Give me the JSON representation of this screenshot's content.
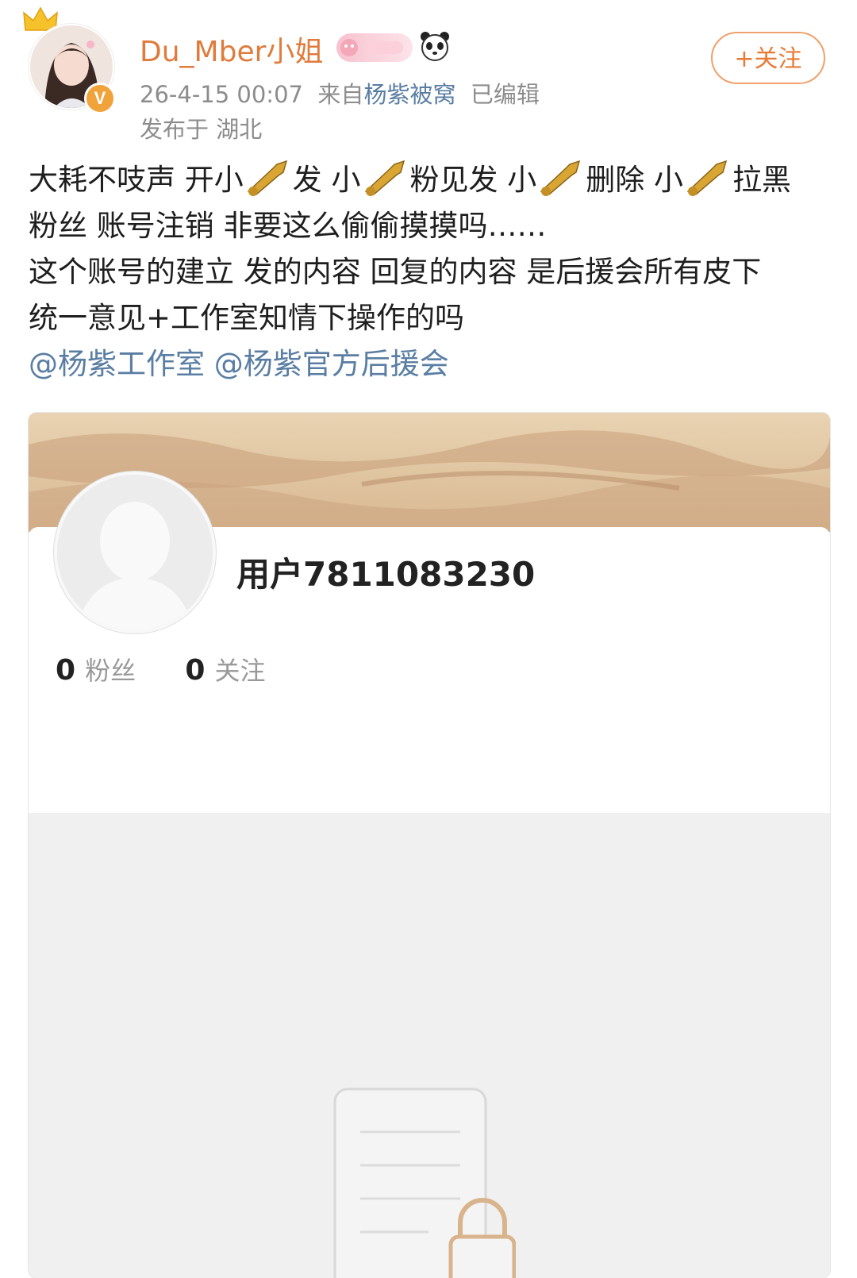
{
  "header": {
    "username": "Du_Mber小姐",
    "meta_time": "26-4-15 00:07",
    "meta_from_prefix": "来自",
    "meta_source": "杨紫被窝",
    "meta_edited": "已编辑",
    "location": "发布于 湖北",
    "verified_mark": "V",
    "follow_label": "+关注"
  },
  "post": {
    "l1a": "大耗不吱声 开小",
    "l1b": "发 小",
    "l1c": "粉见发 小",
    "l1d": "删除 小",
    "l1e": "拉黑",
    "l2": "粉丝 账号注销 非要这么偷偷摸摸吗……",
    "l3": "这个账号的建立 发的内容 回复的内容 是后援会所有皮下",
    "l4": "统一意见+工作室知情下操作的吗",
    "mention1": "@杨紫工作室",
    "mention2": "@杨紫官方后援会"
  },
  "card": {
    "name": "用户7811083230",
    "fans_count": "0",
    "fans_label": "粉丝",
    "follow_count": "0",
    "follow_label": "关注"
  },
  "icons": {
    "emoji": "trumpet-icon",
    "colors": {
      "accent": "#e07b3c",
      "link": "#5a7ea3"
    }
  }
}
